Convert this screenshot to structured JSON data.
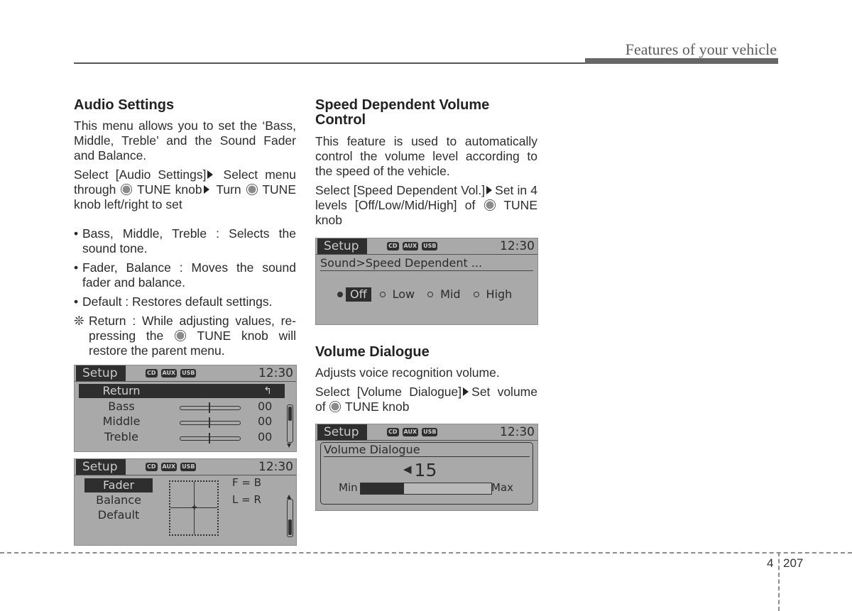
{
  "header": {
    "title": "Features of your vehicle"
  },
  "left_column": {
    "heading": "Audio Settings",
    "intro": "This menu allows you to set the ‘Bass, Middle, Treble’ and the Sound Fader and Balance.",
    "instruction_parts": [
      "Select [Audio Settings]",
      "Select menu through",
      "TUNE knob",
      "Turn",
      "TUNE knob left/right to set"
    ],
    "bullets": [
      "Bass, Middle, Treble : Selects the sound tone.",
      "Fader, Balance : Moves the sound fader and balance.",
      "Default : Restores default settings."
    ],
    "note": {
      "mark": "❊",
      "parts": [
        "Return : While adjusting values, re-pressing the",
        "TUNE knob will restore the parent menu."
      ]
    }
  },
  "screen_common": {
    "setup_label": "Setup",
    "badges": [
      "CD",
      "AUX",
      "USB"
    ],
    "time": "12:30"
  },
  "screen_tone": {
    "return_label": "Return",
    "return_icon": "↰",
    "rows": [
      {
        "label": "Bass",
        "value": "00",
        "position": 0.5
      },
      {
        "label": "Middle",
        "value": "00",
        "position": 0.5
      },
      {
        "label": "Treble",
        "value": "00",
        "position": 0.5
      }
    ]
  },
  "screen_fader": {
    "menu": [
      "Fader",
      "Balance",
      "Default"
    ],
    "selected": "Fader",
    "fader_readout": "F = B",
    "balance_readout": "L = R"
  },
  "right_column": {
    "speed": {
      "heading": "Speed Dependent Volume Control",
      "intro": "This feature is used to automatically control the volume level according to the speed of the vehicle.",
      "instruction_parts": [
        "Select [Speed Dependent Vol.]",
        "Set in 4 levels [Off/Low/Mid/High] of",
        "TUNE knob"
      ]
    },
    "dialogue": {
      "heading": "Volume Dialogue",
      "intro": "Adjusts voice recognition volume.",
      "instruction_parts": [
        "Select [Volume Dialogue]",
        "Set volume of",
        "TUNE knob"
      ]
    }
  },
  "screen_speed": {
    "path": "Sound>Speed Dependent ...",
    "options": [
      "Off",
      "Low",
      "Mid",
      "High"
    ],
    "selected": "Off"
  },
  "screen_dialogue": {
    "title": "Volume Dialogue",
    "speaker_icon": "◀",
    "volume": "15",
    "min_label": "Min",
    "max_label": "Max",
    "level_fraction": 0.33
  },
  "footer": {
    "chapter": "4",
    "page": "207"
  }
}
